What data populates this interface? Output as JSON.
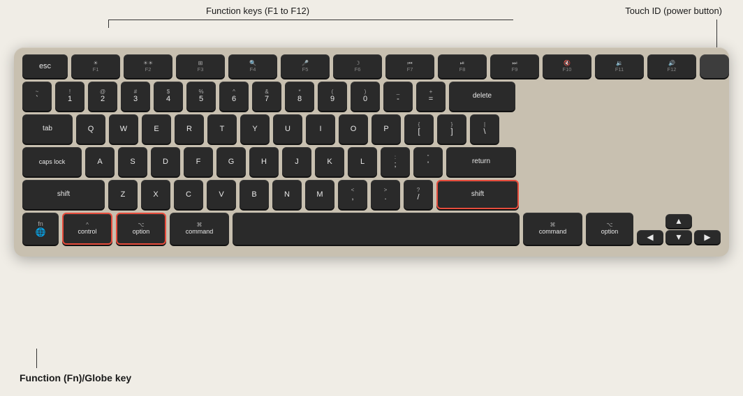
{
  "annotations": {
    "function_keys": "Function keys (F1 to F12)",
    "touch_id": "Touch ID (power button)",
    "fn_globe": "Function (Fn)/Globe key"
  },
  "keyboard": {
    "rows": {
      "fn_row": [
        "esc",
        "F1",
        "F2",
        "F3",
        "F4",
        "F5",
        "F6",
        "F7",
        "F8",
        "F9",
        "F10",
        "F11",
        "F12"
      ],
      "number_row": [
        "~\n`",
        "!\n1",
        "@\n2",
        "#\n3",
        "$\n4",
        "%\n5",
        "^\n6",
        "&\n7",
        "*\n8",
        "(\n9",
        ")\n0",
        "_\n-",
        "+\n=",
        "delete"
      ],
      "qwerty_row": [
        "tab",
        "Q",
        "W",
        "E",
        "R",
        "T",
        "Y",
        "U",
        "I",
        "O",
        "P",
        "{\n[",
        "}\n]",
        "|\n\\"
      ],
      "home_row": [
        "caps lock",
        "A",
        "S",
        "D",
        "F",
        "G",
        "H",
        "J",
        "K",
        "L",
        ":\n;",
        "\"\n'",
        "return"
      ],
      "shift_row": [
        "shift",
        "Z",
        "X",
        "C",
        "V",
        "B",
        "N",
        "M",
        "<\n,",
        ">\n.",
        "?\n/",
        "shift"
      ],
      "bottom_row": [
        "fn\n🌐",
        "control",
        "option",
        "command",
        "",
        "command",
        "option"
      ]
    }
  }
}
